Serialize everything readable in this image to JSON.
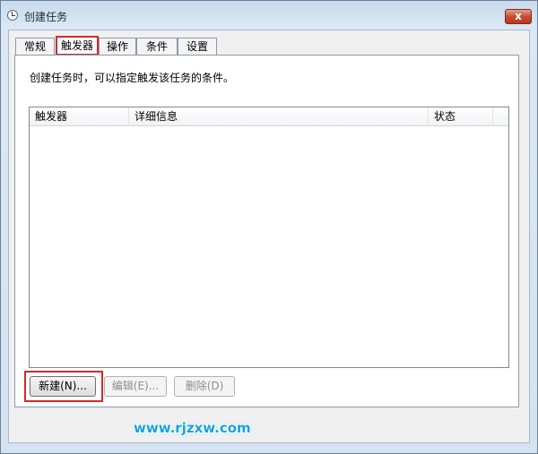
{
  "window": {
    "title": "创建任务",
    "close_label": "x"
  },
  "tabs": [
    {
      "label": "常规"
    },
    {
      "label": "触发器",
      "active": true
    },
    {
      "label": "操作"
    },
    {
      "label": "条件"
    },
    {
      "label": "设置"
    }
  ],
  "triggers": {
    "description": "创建任务时，可以指定触发该任务的条件。",
    "columns": [
      "触发器",
      "详细信息",
      "状态"
    ],
    "rows": []
  },
  "buttons": {
    "new_label": "新建(N)...",
    "edit_label": "编辑(E)...",
    "delete_label": "删除(D)"
  },
  "watermark": "www.rjzxw.com",
  "colors": {
    "highlight": "#d42a2a",
    "close_button": "#c94a33",
    "watermark": "#1aa0e0"
  }
}
